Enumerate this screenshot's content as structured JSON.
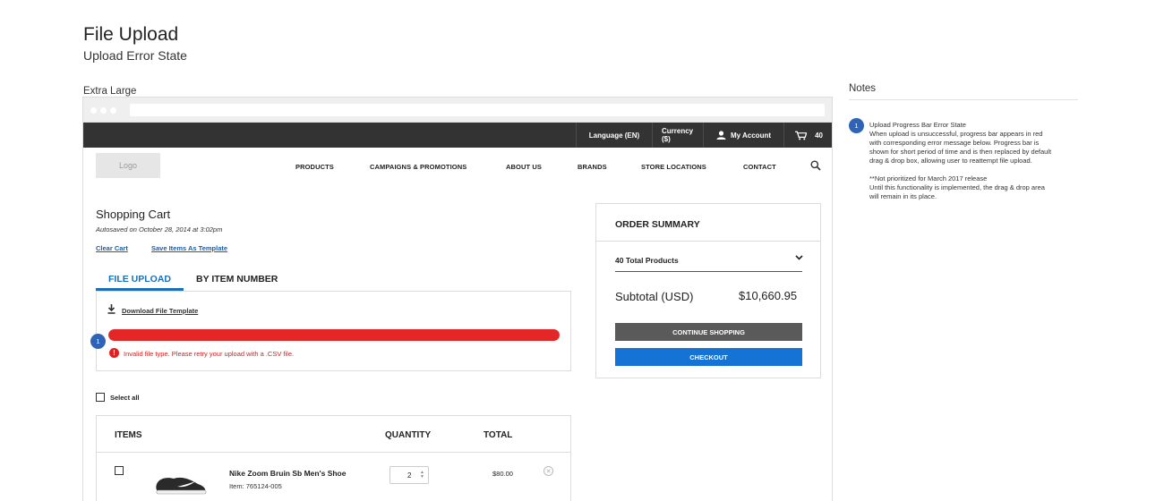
{
  "page": {
    "title": "File Upload",
    "subtitle": "Upload Error State",
    "viewport_label": "Extra Large"
  },
  "topbar": {
    "language": "Language (EN)",
    "currency": "Currency ($)",
    "account": "My Account",
    "cart_count": "40"
  },
  "nav": {
    "logo": "Logo",
    "items": [
      "PRODUCTS",
      "CAMPAIGNS & PROMOTIONS",
      "ABOUT US",
      "BRANDS",
      "STORE LOCATIONS",
      "CONTACT"
    ]
  },
  "cart": {
    "title": "Shopping Cart",
    "autosaved": "Autosaved on October 28, 2014 at 3:02pm",
    "clear_cart": "Clear Cart",
    "save_template": "Save Items As Template"
  },
  "tabs": {
    "file_upload": "FILE UPLOAD",
    "by_item_number": "BY ITEM NUMBER"
  },
  "upload": {
    "download_template": "Download File Template",
    "progress": 1.0,
    "progress_color": "#e32626",
    "error_message": "Invalid file type. Please retry your upload with a .CSV file.",
    "error_icon": "!",
    "marker": "1"
  },
  "select_all": "Select all",
  "table": {
    "headers": {
      "items": "ITEMS",
      "quantity": "QUANTITY",
      "total": "TOTAL"
    },
    "rows": [
      {
        "name": "Nike Zoom Bruin Sb Men's Shoe",
        "item": "Item: 765124-005",
        "quantity": "2",
        "total": "$80.00"
      }
    ]
  },
  "summary": {
    "title": "ORDER SUMMARY",
    "products": "40 Total Products",
    "subtotal_label": "Subtotal (USD)",
    "subtotal_value": "$10,660.95",
    "continue_label": "CONTINUE SHOPPING",
    "checkout_label": "CHECKOUT",
    "continue_color": "#5a5a5a",
    "checkout_color": "#1473d4"
  },
  "notes": {
    "title": "Notes",
    "marker": "1",
    "heading": "Upload Progress Bar Error State",
    "line1": "When upload is unsuccessful, progress bar appears in red",
    "line2": "with corresponding error message below.  Progress bar is",
    "line3": "shown for short period of time and is then replaced by default",
    "line4": "drag & drop box, allowing user to reattempt file upload.",
    "line5": "**Not prioritized for March 2017 release",
    "line6": "Until this functionality is implemented, the drag & drop area",
    "line7": "will remain in its place."
  }
}
